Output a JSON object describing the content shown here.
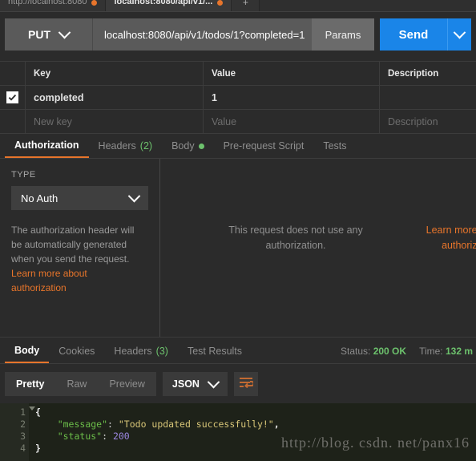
{
  "app": {
    "accent_orange": "#e8752b",
    "accent_blue": "#1a85e8",
    "accent_green": "#6dc26d"
  },
  "tabstrip": {
    "tabs": [
      {
        "label": "http://localhost:8080",
        "unsaved": true,
        "active": false
      },
      {
        "label": "localhost:8080/api/v1/...",
        "unsaved": true,
        "active": true
      }
    ],
    "new_tab_label": "+"
  },
  "request_bar": {
    "method": "PUT",
    "url": "localhost:8080/api/v1/todos/1?completed=1",
    "params_label": "Params",
    "send_label": "Send"
  },
  "params_table": {
    "columns": [
      "Key",
      "Value",
      "Description"
    ],
    "rows": [
      {
        "checked": true,
        "key": "completed",
        "value": "1",
        "description": ""
      }
    ],
    "new_row": {
      "key_placeholder": "New key",
      "value_placeholder": "Value",
      "description_placeholder": "Description"
    }
  },
  "request_tabs": [
    {
      "label": "Authorization",
      "active": true
    },
    {
      "label": "Headers",
      "count": "(2)",
      "active": false
    },
    {
      "label": "Body",
      "dot": true,
      "active": false
    },
    {
      "label": "Pre-request Script",
      "active": false
    },
    {
      "label": "Tests",
      "active": false
    }
  ],
  "authorization": {
    "type_label": "TYPE",
    "type_value": "No Auth",
    "note_line1": "The authorization header will",
    "note_line2": "be automatically generated",
    "note_line3": "when you send the request.",
    "link_line1": "Learn more about",
    "link_line2": "authorization",
    "center_line1": "This request does not use any",
    "center_line2": "authorization.",
    "right_link_line1": "Learn more a",
    "right_link_line2": "authorizat"
  },
  "response_tabs": [
    {
      "label": "Body",
      "active": true
    },
    {
      "label": "Cookies",
      "active": false
    },
    {
      "label": "Headers",
      "count": "(3)",
      "active": false
    },
    {
      "label": "Test Results",
      "active": false
    }
  ],
  "response_meta": {
    "status_label": "Status:",
    "status_value": "200 OK",
    "time_label": "Time:",
    "time_value": "132 m"
  },
  "format_bar": {
    "modes": [
      {
        "label": "Pretty",
        "active": true
      },
      {
        "label": "Raw",
        "active": false
      },
      {
        "label": "Preview",
        "active": false
      }
    ],
    "language": "JSON",
    "wrap_icon": "wrap-lines-icon"
  },
  "response_body": {
    "line_numbers": [
      "1",
      "2",
      "3",
      "4"
    ],
    "lines": [
      {
        "indent": 0,
        "parts": [
          {
            "t": "punct",
            "v": "{"
          }
        ]
      },
      {
        "indent": 4,
        "parts": [
          {
            "t": "key",
            "v": "\"message\""
          },
          {
            "t": "colon",
            "v": ": "
          },
          {
            "t": "str",
            "v": "\"Todo updated successfully!\""
          },
          {
            "t": "punct",
            "v": ","
          }
        ]
      },
      {
        "indent": 4,
        "parts": [
          {
            "t": "key",
            "v": "\"status\""
          },
          {
            "t": "colon",
            "v": ": "
          },
          {
            "t": "num",
            "v": "200"
          }
        ]
      },
      {
        "indent": 0,
        "parts": [
          {
            "t": "punct",
            "v": "}"
          }
        ]
      }
    ]
  },
  "watermark": "http://blog. csdn. net/panx16"
}
